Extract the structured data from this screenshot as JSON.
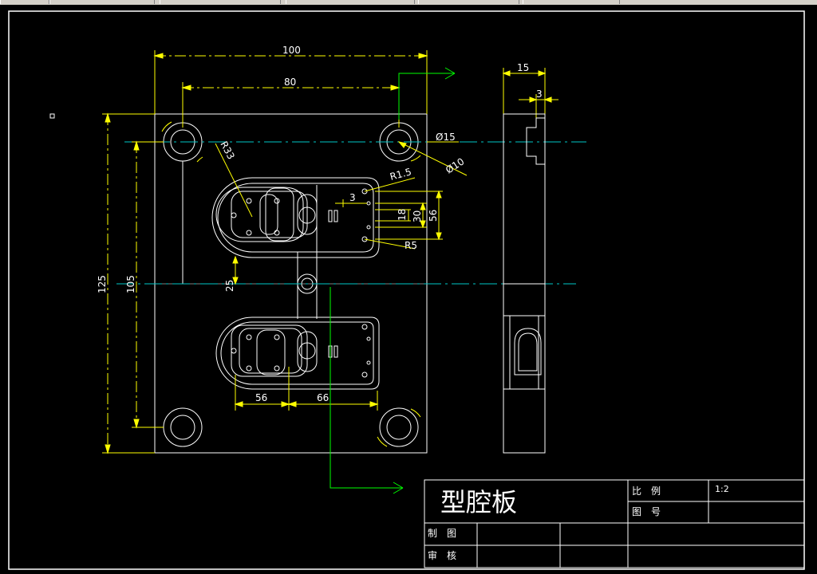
{
  "drawing": {
    "dimensions": {
      "width_overall": "100",
      "hole_spacing_x": "80",
      "height_overall": "125",
      "hole_spacing_y": "105",
      "radius_large": "R33",
      "hole_diameter_outer": "Ø15",
      "hole_diameter_inner": "Ø10",
      "corner_radius": "R1.5",
      "small_offset": "3",
      "slot_height": "18",
      "inner_height": "30",
      "pocket_height": "56",
      "small_radius": "R5",
      "offset_center": "25",
      "cavity_width_left": "56",
      "cavity_width_right": "66",
      "side_thickness": "15",
      "side_step": "3"
    },
    "title_block": {
      "title": "型腔板",
      "scale_label": "比　例",
      "scale_value": "1:2",
      "drawing_no_label": "图　号",
      "drawn_by_label": "制　图",
      "checked_by_label": "审　核"
    }
  },
  "colors": {
    "background": "#000000",
    "outline": "#ffffff",
    "dimension": "#ffff00",
    "centerline": "#00c8c8",
    "section_arrow": "#00ff00",
    "border": "#ffffff"
  }
}
